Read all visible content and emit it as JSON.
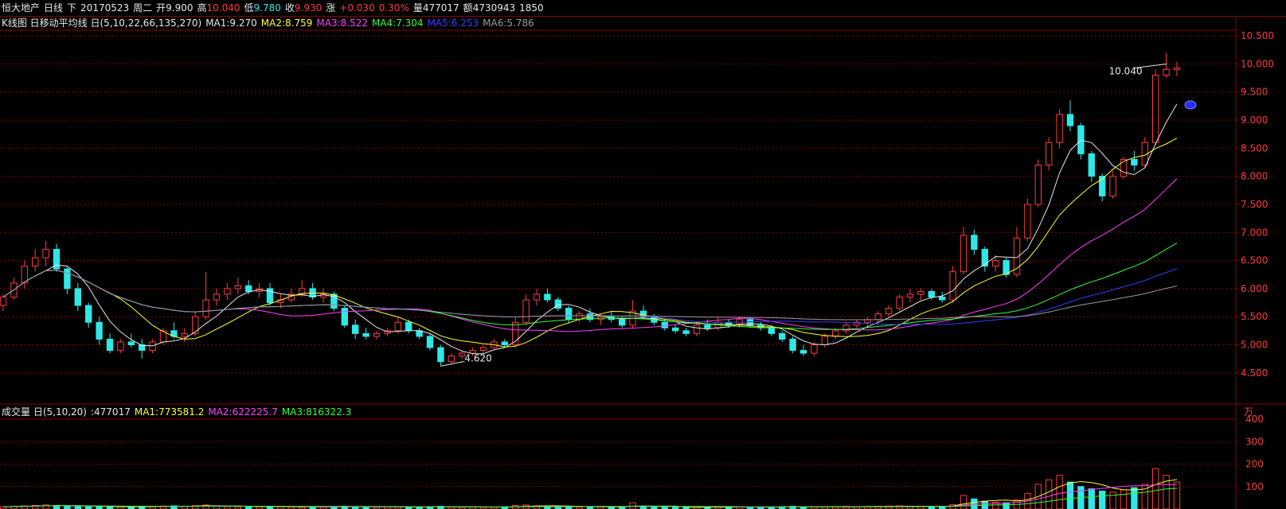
{
  "header": {
    "stock_name": "恒大地产",
    "period": "日线",
    "direction": "下",
    "date": "20170523",
    "weekday": "周二",
    "open_label": "开",
    "open_value": "9.900",
    "high_label": "高",
    "high_value": "10.040",
    "low_label": "低",
    "low_value": "9.780",
    "close_label": "收",
    "close_value": "9.930",
    "change_label": "涨",
    "change_value": "+0.030",
    "change_pct": "0.30%",
    "volume_label": "量",
    "volume_value": "477017",
    "amount_label": "额",
    "amount_value": "4730943",
    "extra": "1850"
  },
  "kline_legend": {
    "title": "K线图 日移动平均线 日(5,10,22,66,135,270)",
    "ma1": "MA1:9.270",
    "ma2": "MA2:8.759",
    "ma3": "MA3:8.522",
    "ma4": "MA4:7.304",
    "ma5": "MA5:6.253",
    "ma6": "MA6:5.786"
  },
  "volume_legend": {
    "title": "成交量 日(5,10,20)",
    "current": ":477017",
    "ma1": "MA1:773581.2",
    "ma2": "MA2:622225.7",
    "ma3": "MA3:816322.3"
  },
  "colors": {
    "up": "#ff3b3b",
    "down": "#2ee8e8",
    "ma1": "#e8e8e8",
    "ma2": "#ffff33",
    "ma3": "#ff40ff",
    "ma4": "#33ff33",
    "ma5": "#3a3aff",
    "ma6": "#9a9a9a",
    "grid": "#8a0000",
    "axis_text": "#ff3b3b"
  },
  "chart_data": [
    {
      "type": "candlestick",
      "y_ticks": [
        "10.500",
        "10.000",
        "9.500",
        "9.000",
        "8.500",
        "8.000",
        "7.500",
        "7.000",
        "6.500",
        "6.000",
        "5.500",
        "5.000",
        "4.500"
      ],
      "ylim": [
        4.2,
        10.6
      ],
      "annotations": [
        {
          "label": "10.040",
          "value": 10.04
        },
        {
          "label": "4.620",
          "value": 4.62
        }
      ],
      "candles": [
        [
          5.7,
          5.9,
          5.6,
          5.85
        ],
        [
          5.85,
          6.2,
          5.8,
          6.1
        ],
        [
          6.1,
          6.5,
          6.0,
          6.4
        ],
        [
          6.4,
          6.7,
          6.3,
          6.55
        ],
        [
          6.55,
          6.85,
          6.4,
          6.7
        ],
        [
          6.7,
          6.8,
          6.3,
          6.35
        ],
        [
          6.35,
          6.4,
          5.9,
          6.0
        ],
        [
          6.0,
          6.1,
          5.6,
          5.7
        ],
        [
          5.7,
          5.75,
          5.3,
          5.4
        ],
        [
          5.4,
          5.5,
          5.0,
          5.1
        ],
        [
          5.1,
          5.2,
          4.85,
          4.9
        ],
        [
          4.9,
          5.1,
          4.85,
          5.05
        ],
        [
          5.05,
          5.2,
          4.95,
          5.0
        ],
        [
          5.0,
          5.1,
          4.75,
          4.9
        ],
        [
          4.9,
          5.1,
          4.85,
          5.05
        ],
        [
          5.05,
          5.3,
          5.0,
          5.25
        ],
        [
          5.25,
          5.4,
          5.1,
          5.15
        ],
        [
          5.15,
          5.3,
          5.05,
          5.2
        ],
        [
          5.2,
          5.6,
          5.15,
          5.5
        ],
        [
          5.5,
          6.3,
          5.45,
          5.8
        ],
        [
          5.8,
          6.0,
          5.7,
          5.9
        ],
        [
          5.9,
          6.1,
          5.8,
          6.0
        ],
        [
          6.0,
          6.2,
          5.9,
          6.05
        ],
        [
          6.05,
          6.15,
          5.9,
          5.95
        ],
        [
          5.95,
          6.1,
          5.85,
          6.0
        ],
        [
          6.0,
          6.1,
          5.7,
          5.75
        ],
        [
          5.75,
          5.9,
          5.65,
          5.8
        ],
        [
          5.8,
          6.0,
          5.75,
          5.9
        ],
        [
          5.9,
          6.15,
          5.85,
          6.0
        ],
        [
          6.0,
          6.1,
          5.8,
          5.85
        ],
        [
          5.85,
          6.0,
          5.75,
          5.9
        ],
        [
          5.9,
          5.95,
          5.6,
          5.65
        ],
        [
          5.65,
          5.7,
          5.3,
          5.35
        ],
        [
          5.35,
          5.45,
          5.1,
          5.2
        ],
        [
          5.2,
          5.3,
          5.1,
          5.15
        ],
        [
          5.15,
          5.25,
          5.1,
          5.2
        ],
        [
          5.2,
          5.3,
          5.15,
          5.25
        ],
        [
          5.25,
          5.5,
          5.2,
          5.4
        ],
        [
          5.4,
          5.45,
          5.2,
          5.25
        ],
        [
          5.25,
          5.3,
          5.1,
          5.15
        ],
        [
          5.15,
          5.2,
          4.9,
          4.95
        ],
        [
          4.95,
          5.0,
          4.62,
          4.7
        ],
        [
          4.7,
          4.85,
          4.65,
          4.8
        ],
        [
          4.8,
          4.9,
          4.75,
          4.85
        ],
        [
          4.85,
          4.95,
          4.8,
          4.9
        ],
        [
          4.9,
          5.0,
          4.85,
          4.95
        ],
        [
          4.95,
          5.1,
          4.9,
          5.05
        ],
        [
          5.05,
          5.1,
          4.95,
          5.0
        ],
        [
          5.0,
          5.5,
          4.95,
          5.4
        ],
        [
          5.4,
          5.9,
          5.35,
          5.8
        ],
        [
          5.8,
          6.0,
          5.7,
          5.9
        ],
        [
          5.9,
          6.0,
          5.75,
          5.8
        ],
        [
          5.8,
          5.85,
          5.6,
          5.65
        ],
        [
          5.65,
          5.7,
          5.4,
          5.45
        ],
        [
          5.45,
          5.6,
          5.4,
          5.55
        ],
        [
          5.55,
          5.65,
          5.4,
          5.45
        ],
        [
          5.45,
          5.55,
          5.35,
          5.5
        ],
        [
          5.5,
          5.6,
          5.4,
          5.45
        ],
        [
          5.45,
          5.5,
          5.3,
          5.35
        ],
        [
          5.35,
          5.8,
          5.3,
          5.6
        ],
        [
          5.6,
          5.7,
          5.45,
          5.5
        ],
        [
          5.5,
          5.55,
          5.35,
          5.4
        ],
        [
          5.4,
          5.45,
          5.25,
          5.3
        ],
        [
          5.3,
          5.35,
          5.2,
          5.25
        ],
        [
          5.25,
          5.3,
          5.15,
          5.2
        ],
        [
          5.2,
          5.4,
          5.15,
          5.35
        ],
        [
          5.35,
          5.45,
          5.25,
          5.3
        ],
        [
          5.3,
          5.5,
          5.25,
          5.4
        ],
        [
          5.4,
          5.45,
          5.3,
          5.35
        ],
        [
          5.35,
          5.5,
          5.3,
          5.45
        ],
        [
          5.45,
          5.5,
          5.3,
          5.35
        ],
        [
          5.35,
          5.4,
          5.25,
          5.3
        ],
        [
          5.3,
          5.35,
          5.15,
          5.2
        ],
        [
          5.2,
          5.25,
          5.05,
          5.1
        ],
        [
          5.1,
          5.15,
          4.85,
          4.9
        ],
        [
          4.9,
          5.0,
          4.8,
          4.85
        ],
        [
          4.85,
          5.05,
          4.8,
          5.0
        ],
        [
          5.0,
          5.2,
          4.95,
          5.15
        ],
        [
          5.15,
          5.3,
          5.1,
          5.25
        ],
        [
          5.25,
          5.4,
          5.2,
          5.35
        ],
        [
          5.35,
          5.45,
          5.3,
          5.4
        ],
        [
          5.4,
          5.5,
          5.3,
          5.45
        ],
        [
          5.45,
          5.6,
          5.4,
          5.55
        ],
        [
          5.55,
          5.7,
          5.5,
          5.65
        ],
        [
          5.65,
          5.9,
          5.6,
          5.85
        ],
        [
          5.85,
          6.0,
          5.75,
          5.9
        ],
        [
          5.9,
          6.0,
          5.8,
          5.95
        ],
        [
          5.95,
          6.0,
          5.8,
          5.85
        ],
        [
          5.85,
          5.95,
          5.75,
          5.8
        ],
        [
          5.8,
          6.4,
          5.75,
          6.3
        ],
        [
          6.3,
          7.1,
          6.25,
          6.95
        ],
        [
          6.95,
          7.05,
          6.6,
          6.7
        ],
        [
          6.7,
          6.75,
          6.3,
          6.4
        ],
        [
          6.4,
          6.6,
          6.3,
          6.5
        ],
        [
          6.5,
          6.55,
          6.2,
          6.25
        ],
        [
          6.25,
          7.1,
          6.2,
          6.9
        ],
        [
          6.9,
          7.6,
          6.85,
          7.5
        ],
        [
          7.5,
          8.3,
          7.45,
          8.2
        ],
        [
          8.2,
          8.7,
          8.1,
          8.6
        ],
        [
          8.6,
          9.2,
          8.5,
          9.1
        ],
        [
          9.1,
          9.35,
          8.8,
          8.9
        ],
        [
          8.9,
          8.95,
          8.3,
          8.4
        ],
        [
          8.4,
          8.45,
          7.9,
          8.0
        ],
        [
          8.0,
          8.05,
          7.55,
          7.65
        ],
        [
          7.65,
          8.1,
          7.6,
          8.0
        ],
        [
          8.0,
          8.35,
          7.95,
          8.3
        ],
        [
          8.3,
          8.45,
          8.1,
          8.2
        ],
        [
          8.2,
          8.7,
          8.15,
          8.6
        ],
        [
          8.6,
          9.9,
          8.55,
          9.8
        ],
        [
          9.8,
          10.2,
          9.75,
          9.9
        ],
        [
          9.9,
          10.04,
          9.78,
          9.93
        ]
      ],
      "volume": [
        10,
        12,
        14,
        16,
        18,
        15,
        13,
        12,
        11,
        10,
        9,
        10,
        11,
        12,
        10,
        13,
        14,
        12,
        15,
        18,
        12,
        11,
        10,
        9,
        11,
        12,
        10,
        9,
        8,
        9,
        10,
        11,
        12,
        9,
        8,
        8,
        9,
        10,
        9,
        8,
        10,
        12,
        9,
        8,
        9,
        8,
        9,
        10,
        16,
        18,
        14,
        12,
        11,
        10,
        9,
        9,
        10,
        9,
        8,
        28,
        10,
        9,
        8,
        8,
        7,
        8,
        9,
        10,
        9,
        9,
        8,
        8,
        9,
        10,
        12,
        10,
        9,
        10,
        11,
        12,
        10,
        11,
        12,
        13,
        14,
        12,
        11,
        10,
        12,
        20,
        60,
        45,
        35,
        30,
        28,
        40,
        70,
        110,
        130,
        150,
        120,
        100,
        90,
        80,
        75,
        85,
        95,
        110,
        180,
        150,
        120
      ]
    },
    {
      "type": "bar",
      "y_ticks": [
        "400",
        "300",
        "200",
        "100"
      ],
      "unit": "万",
      "ylim": [
        0,
        400
      ]
    }
  ]
}
